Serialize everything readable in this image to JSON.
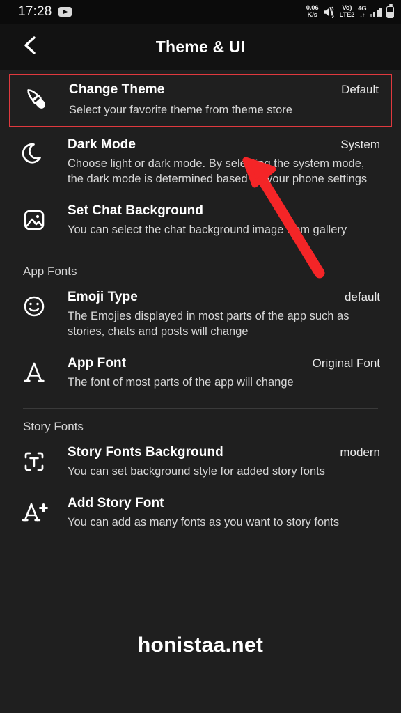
{
  "status_bar": {
    "clock": "17:28",
    "app_badge_icon": "youtube-icon",
    "net_speed_value": "0.06",
    "net_speed_unit": "K/s",
    "mute_icon": "volume-mute-icon",
    "volte_line1": "Vo)",
    "volte_line2": "LTE2",
    "network_type": "4G",
    "data_arrows": "↓↑",
    "signal_icon": "signal-bars-icon",
    "battery_icon": "battery-icon"
  },
  "appbar": {
    "back_icon": "chevron-left-icon",
    "title": "Theme & UI"
  },
  "colors": {
    "highlight_red": "#e0393e",
    "arrow_red": "#f42527",
    "background": "#1f1f1f",
    "appbar_background": "#121212",
    "statusbar_background": "#0b0b0b"
  },
  "settings": [
    {
      "id": "change-theme",
      "icon": "paint-brush-icon",
      "title": "Change Theme",
      "value": "Default",
      "description": "Select your favorite theme from theme store",
      "highlighted": true
    },
    {
      "id": "dark-mode",
      "icon": "moon-icon",
      "title": "Dark Mode",
      "value": "System",
      "description": "Choose light or dark mode. By selecting the system mode, the dark mode is determined based on your phone settings",
      "highlighted": false
    },
    {
      "id": "set-chat-background",
      "icon": "image-icon",
      "title": "Set Chat Background",
      "value": "",
      "description": "You can select the chat background image from gallery",
      "highlighted": false
    }
  ],
  "sections": [
    {
      "id": "app-fonts",
      "label": "App Fonts",
      "items": [
        {
          "id": "emoji-type",
          "icon": "smiley-face-icon",
          "title": "Emoji Type",
          "value": "default",
          "description": "The Emojies displayed in most parts of the app such as stories, chats and posts will change"
        },
        {
          "id": "app-font",
          "icon": "serif-a-icon",
          "title": "App Font",
          "value": "Original Font",
          "description": "The font of most parts of the app will change"
        }
      ]
    },
    {
      "id": "story-fonts",
      "label": "Story Fonts",
      "items": [
        {
          "id": "story-fonts-background",
          "icon": "text-frame-icon",
          "title": "Story Fonts Background",
          "value": "modern",
          "description": "You can set background style for added story fonts"
        },
        {
          "id": "add-story-font",
          "icon": "a-plus-icon",
          "title": "Add Story Font",
          "value": "",
          "description": "You can add as many fonts as you want to story fonts"
        }
      ]
    }
  ],
  "watermark": "honistaa.net",
  "annotation": {
    "arrow_name": "red-pointer-arrow",
    "points_to": "change-theme"
  }
}
